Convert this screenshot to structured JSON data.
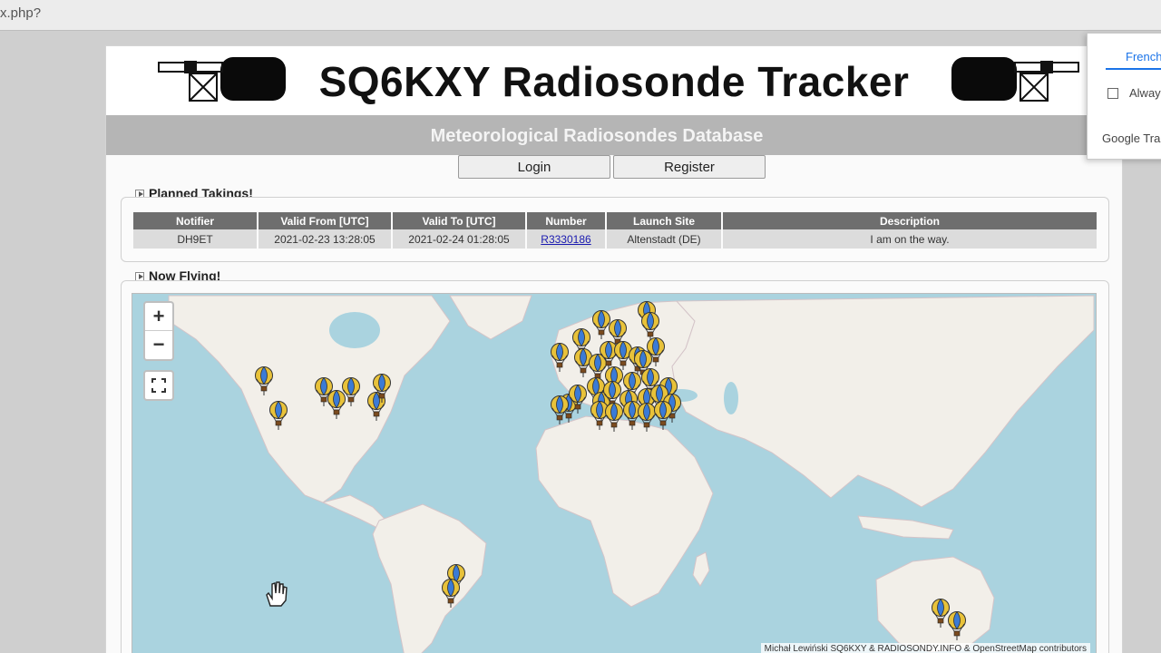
{
  "browser": {
    "url_fragment": "x.php?"
  },
  "header": {
    "title": "SQ6KXY Radiosonde Tracker",
    "subtitle": "Meteorological Radiosondes Database"
  },
  "auth": {
    "login_label": "Login",
    "register_label": "Register"
  },
  "planned": {
    "title": "Planned Takings!",
    "columns": [
      "Notifier",
      "Valid From [UTC]",
      "Valid To [UTC]",
      "Number",
      "Launch Site",
      "Description"
    ],
    "rows": [
      {
        "notifier": "DH9ET",
        "valid_from": "2021-02-23 13:28:05",
        "valid_to": "2021-02-24 01:28:05",
        "number": "R3330186",
        "launch_site": "Altenstadt (DE)",
        "description": "I am on the way."
      }
    ]
  },
  "flying": {
    "title": "Now Flying!",
    "zoom_in": "+",
    "zoom_out": "−",
    "attribution": "Michał Lewiński SQ6KXY & RADIOSONDY.INFO & OpenStreetMap contributors"
  },
  "translate": {
    "language": "French",
    "always": "Alway",
    "brand": "Google Tran"
  },
  "colors": {
    "ocean": "#aad3df",
    "land": "#f2efe9",
    "table_header": "#6e6e6e",
    "subtitle_bar": "#b5b5b5",
    "link": "#1a1ab0"
  },
  "icons": {
    "balloon": "hot-air-balloon-icon",
    "fullscreen": "fullscreen-icon",
    "hand": "hand-cursor-icon"
  }
}
